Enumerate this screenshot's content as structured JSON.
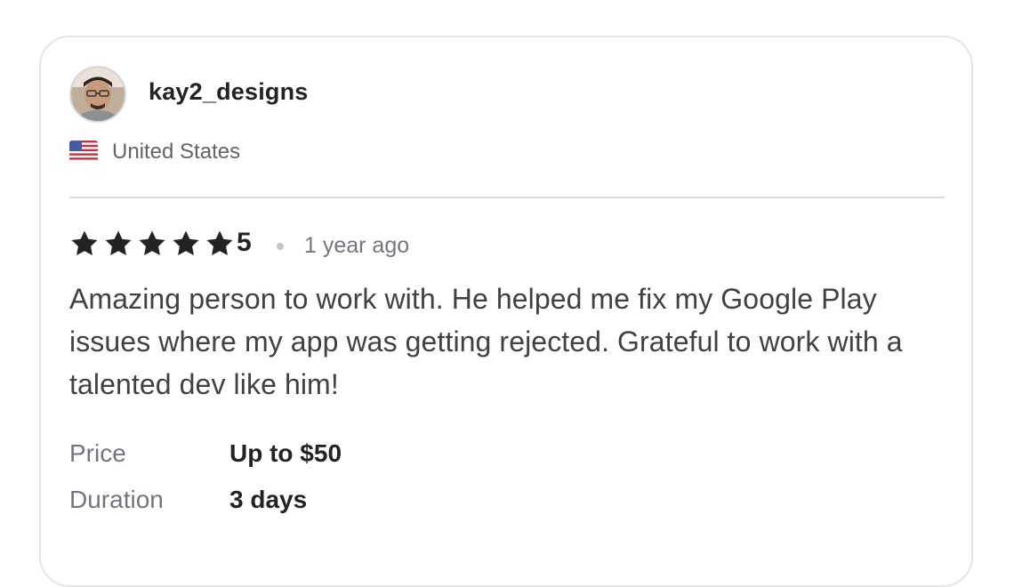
{
  "reviewer": {
    "username": "kay2_designs",
    "country": "United States",
    "avatar_icon": "user-avatar-photo",
    "flag_icon": "us-flag-icon"
  },
  "review": {
    "stars": 5,
    "rating_text": "5",
    "time_ago": "1 year ago",
    "text": "Amazing person to work with. He helped me fix my Google Play issues where my app was getting rejected. Grateful to work with a talented dev like him!",
    "star_color": "#222325"
  },
  "details": {
    "price_label": "Price",
    "price_value": "Up to $50",
    "duration_label": "Duration",
    "duration_value": "3 days"
  }
}
